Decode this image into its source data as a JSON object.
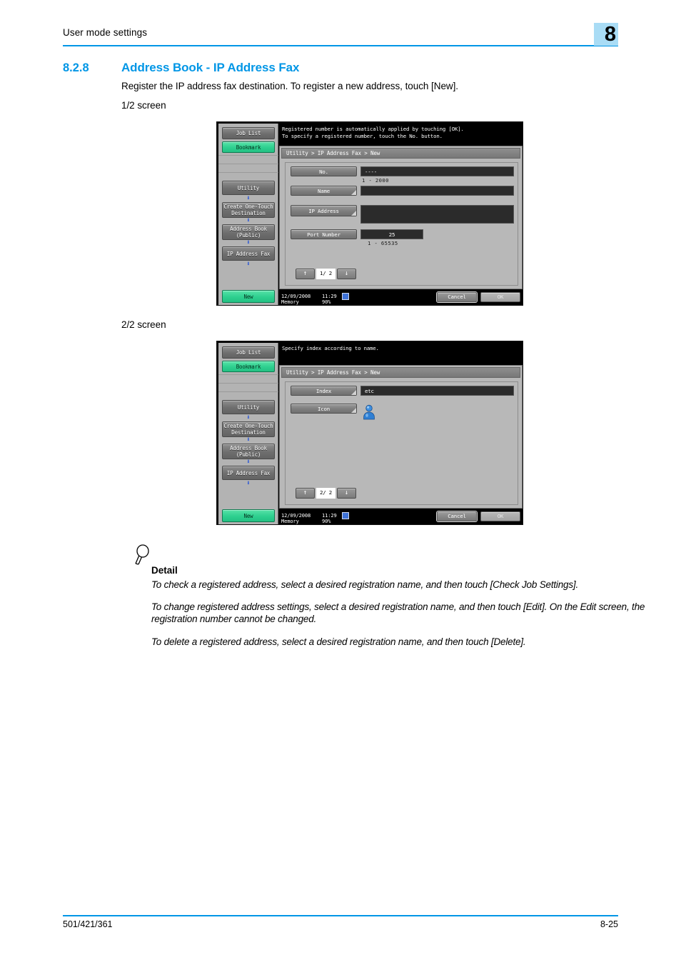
{
  "header": {
    "running_head": "User mode settings",
    "chapter_number": "8",
    "rule_color": "#0096e6",
    "badge_color": "#a9dcf5"
  },
  "section": {
    "number": "8.2.8",
    "title": "Address Book - IP Address Fax",
    "intro": "Register the IP address fax destination. To register a new address, touch [New].",
    "caption_1": "1/2 screen",
    "caption_2": "2/2 screen"
  },
  "screens": [
    {
      "name": "screen-1-of-2",
      "message_line1": "Registered number is automatically applied by touching [OK].",
      "message_line2": "To specify a registered number, touch the No. button.",
      "breadcrumb": "Utility > IP Address Fax > New",
      "rail": [
        {
          "label": "Job List",
          "style": "grey"
        },
        {
          "label": "Bookmark",
          "style": "green"
        },
        {
          "label": "Utility",
          "style": "grey"
        },
        {
          "label": "Create One-Touch\nDestination",
          "style": "grey"
        },
        {
          "label": "Address Book\n(Public)",
          "style": "grey"
        },
        {
          "label": "IP Address Fax",
          "style": "grey"
        },
        {
          "label": "New",
          "style": "green"
        }
      ],
      "rail_labels": {
        "job_list": "Job List",
        "bookmark": "Bookmark",
        "utility": "Utility",
        "one_touch_line1": "Create One-Touch",
        "one_touch_line2": "Destination",
        "address_book_line1": "Address Book",
        "address_book_line2": "(Public)",
        "ip_address_fax": "IP Address Fax",
        "new": "New"
      },
      "fields": [
        {
          "label": "No.",
          "value": "----",
          "range": "1  -  2000"
        },
        {
          "label": "Name",
          "value": "",
          "range": ""
        },
        {
          "label": "IP Address",
          "value": "",
          "range": ""
        },
        {
          "label": "Port Number",
          "value": "25",
          "range": "1   -   65535"
        }
      ],
      "field_labels": {
        "no": "No.",
        "name": "Name",
        "ip_address": "IP Address",
        "port_number": "Port Number"
      },
      "field_values": {
        "no": "----",
        "no_range": "1  -  2000",
        "port": "25",
        "port_range": "1   -   65535"
      },
      "pager": {
        "up": "↑",
        "down": "↓",
        "label": "1/ 2"
      },
      "status": {
        "date": "12/09/2008",
        "time": "11:29",
        "memory_label": "Memory",
        "memory_value": "90%",
        "cancel": "Cancel",
        "ok": "OK"
      }
    },
    {
      "name": "screen-2-of-2",
      "message_line1": "Specify index according to name.",
      "message_line2": "",
      "breadcrumb": "Utility > IP Address Fax > New",
      "rail_labels": {
        "job_list": "Job List",
        "bookmark": "Bookmark",
        "utility": "Utility",
        "one_touch_line1": "Create One-Touch",
        "one_touch_line2": "Destination",
        "address_book_line1": "Address Book",
        "address_book_line2": "(Public)",
        "ip_address_fax": "IP Address Fax",
        "new": "New"
      },
      "field_labels": {
        "index": "Index",
        "icon": "Icon"
      },
      "field_values": {
        "index": "etc",
        "icon": "person-icon"
      },
      "pager": {
        "up": "↑",
        "down": "↓",
        "label": "2/ 2"
      },
      "status": {
        "date": "12/09/2008",
        "time": "11:29",
        "memory_label": "Memory",
        "memory_value": "90%",
        "cancel": "Cancel",
        "ok": "OK"
      }
    }
  ],
  "detail": {
    "icon": "magnifier-icon",
    "title": "Detail",
    "paragraph_1": "To check a registered address, select a desired registration name, and then touch [Check Job Settings].",
    "paragraph_2": "To change registered address settings, select a desired registration name, and then touch [Edit]. On the Edit screen, the registration number cannot be changed.",
    "paragraph_3": "To delete a registered address, select a desired registration name, and then touch [Delete]."
  },
  "footer": {
    "model": "501/421/361",
    "page": "8-25"
  }
}
